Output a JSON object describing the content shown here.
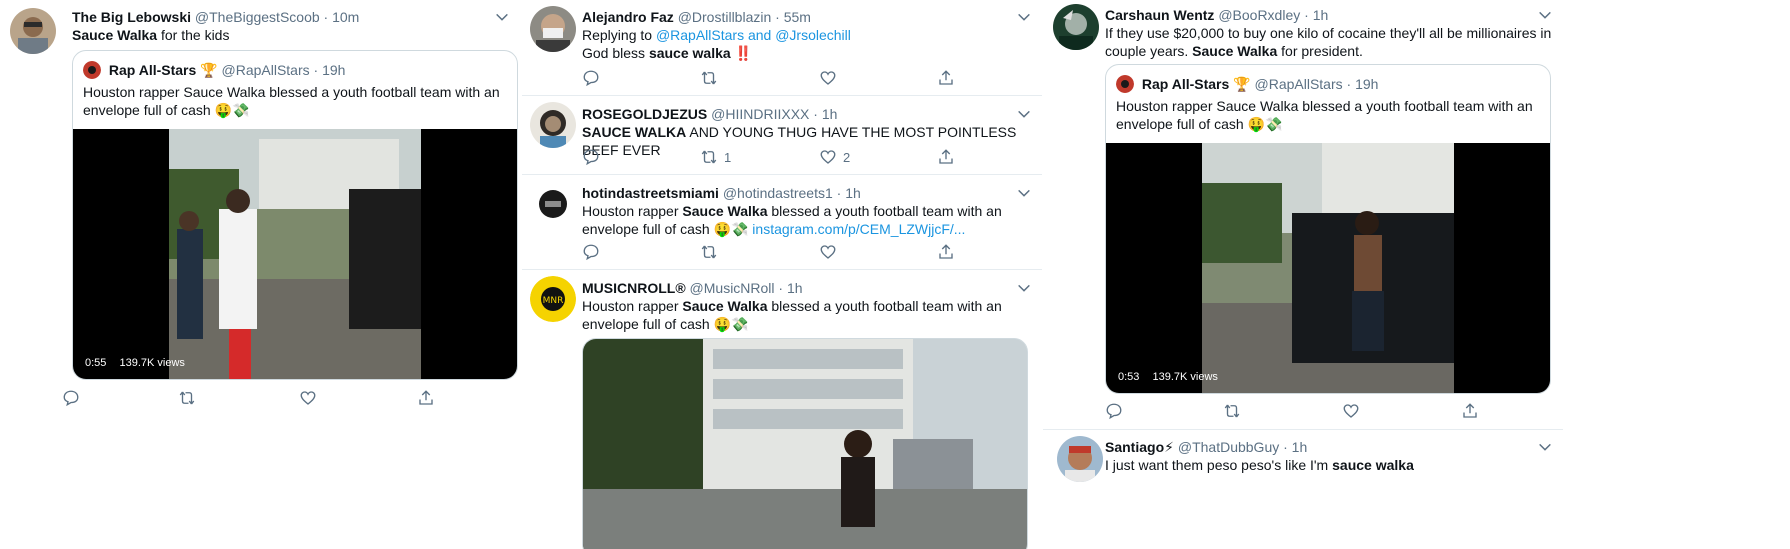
{
  "colors": {
    "handle": "#5b7083",
    "link": "#1b95e0",
    "divider": "#e6ecf0"
  },
  "icons": [
    "chevron-down-icon",
    "reply-icon",
    "retweet-icon",
    "like-icon",
    "share-icon",
    "trophy-icon",
    "money-mouth-emoji",
    "money-wings-emoji",
    "double-exclamation-emoji",
    "lightning-emoji"
  ],
  "column1": {
    "tweet": {
      "name": "The Big Lebowski",
      "handle": "@TheBiggestScoob",
      "time": "· 10m",
      "text_bold": "Sauce Walka",
      "text_rest": " for the kids",
      "quote": {
        "name": "Rap All-Stars",
        "handle": "@RapAllStars",
        "time": "· 19h",
        "text": "Houston rapper Sauce Walka blessed a youth football team with an envelope full of cash",
        "emoji": "🤑💸",
        "video_duration": "0:55",
        "video_views": "139.7K views"
      }
    }
  },
  "column2": {
    "tweets": [
      {
        "name": "Alejandro Faz",
        "handle": "@Drostillblazin",
        "time": "· 55m",
        "replying_prefix": "Replying to ",
        "replying_to_1": "@RapAllStars",
        "replying_and": " and ",
        "replying_to_2": "@Jrsolechill",
        "text_pre": "God bless ",
        "text_bold": "sauce walka",
        "emoji": "‼️"
      },
      {
        "name": "ROSEGOLDJEZUS",
        "handle": "@HIINDRIIXXX",
        "time": "· 1h",
        "text_bold": "SAUCE WALKA",
        "text_rest": " AND YOUNG THUG HAVE THE MOST POINTLESS BEEF EVER",
        "retweets": "1",
        "likes": "2"
      },
      {
        "name": "hotindastreetsmiami",
        "handle": "@hotindastreets1",
        "time": "· 1h",
        "text_pre": "Houston rapper ",
        "text_bold": "Sauce Walka",
        "text_rest": " blessed a youth football team with an envelope full of cash",
        "emoji": "🤑💸",
        "link": "instagram.com/p/CEM_LZWjjcF/..."
      },
      {
        "name": "MUSICNROLL®",
        "handle": "@MusicNRoll",
        "time": "· 1h",
        "text_pre": "Houston rapper ",
        "text_bold": "Sauce Walka",
        "text_rest": " blessed a youth football team with an envelope full of cash",
        "emoji": "🤑💸"
      }
    ]
  },
  "column3": {
    "tweet": {
      "name": "Carshaun Wentz",
      "handle": "@BooRxdley",
      "time": "· 1h",
      "text_pre": "If they use $20,000 to buy one kilo of cocaine they'll all be millionaires in couple years. ",
      "text_bold": "Sauce Walka",
      "text_rest": " for president.",
      "quote": {
        "name": "Rap All-Stars",
        "handle": "@RapAllStars",
        "time": "· 19h",
        "text": "Houston rapper Sauce Walka blessed a youth football team with an envelope full of cash",
        "emoji": "🤑💸",
        "video_duration": "0:53",
        "video_views": "139.7K views"
      }
    },
    "tweet2": {
      "name": "Santiago",
      "name_emoji": "⚡",
      "handle": "@ThatDubbGuy",
      "time": "· 1h",
      "text_pre": "I just want them peso peso's like I'm ",
      "text_bold": "sauce walka"
    }
  }
}
